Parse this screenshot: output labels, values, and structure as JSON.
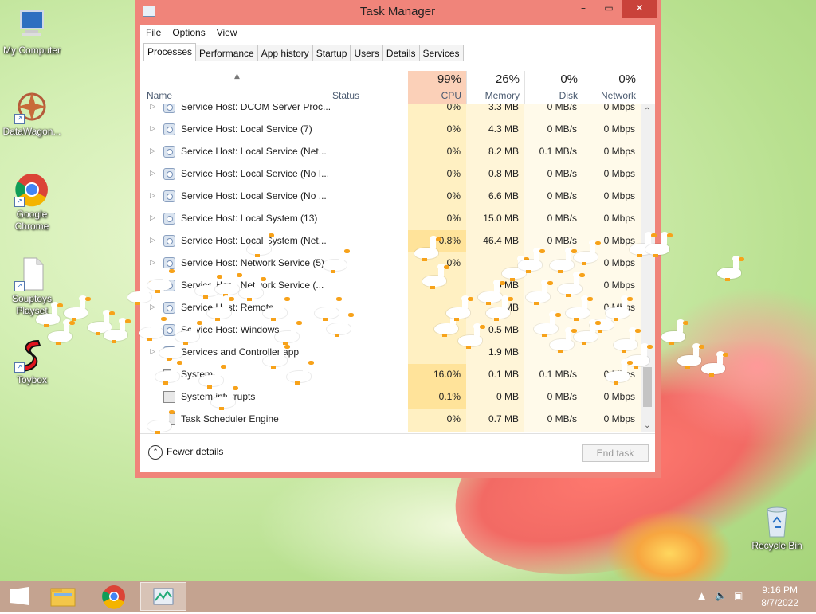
{
  "desktop": {
    "icons": [
      {
        "label": "My Computer"
      },
      {
        "label": "DataWagon..."
      },
      {
        "label": "Google Chrome"
      },
      {
        "label": "Souptoys Playset"
      },
      {
        "label": "Toybox"
      },
      {
        "label": "Recycle Bin"
      }
    ]
  },
  "window": {
    "title": "Task Manager",
    "menu": [
      "File",
      "Options",
      "View"
    ],
    "tabs": [
      "Processes",
      "Performance",
      "App history",
      "Startup",
      "Users",
      "Details",
      "Services"
    ],
    "active_tab": "Processes",
    "columns": {
      "name": "Name",
      "status": "Status",
      "cpu": {
        "pct": "99%",
        "label": "CPU"
      },
      "memory": {
        "pct": "26%",
        "label": "Memory"
      },
      "disk": {
        "pct": "0%",
        "label": "Disk"
      },
      "network": {
        "pct": "0%",
        "label": "Network"
      }
    },
    "rows": [
      {
        "name": "Service Host: DCOM Server Proc...",
        "cpu": "0%",
        "mem": "3.3 MB",
        "disk": "0 MB/s",
        "net": "0 Mbps",
        "icon": "gear"
      },
      {
        "name": "Service Host: Local Service (7)",
        "cpu": "0%",
        "mem": "4.3 MB",
        "disk": "0 MB/s",
        "net": "0 Mbps",
        "icon": "gear"
      },
      {
        "name": "Service Host: Local Service (Net...",
        "cpu": "0%",
        "mem": "8.2 MB",
        "disk": "0.1 MB/s",
        "net": "0 Mbps",
        "icon": "gear"
      },
      {
        "name": "Service Host: Local Service (No I...",
        "cpu": "0%",
        "mem": "0.8 MB",
        "disk": "0 MB/s",
        "net": "0 Mbps",
        "icon": "gear"
      },
      {
        "name": "Service Host: Local Service (No ...",
        "cpu": "0%",
        "mem": "6.6 MB",
        "disk": "0 MB/s",
        "net": "0 Mbps",
        "icon": "gear"
      },
      {
        "name": "Service Host: Local System (13)",
        "cpu": "0%",
        "mem": "15.0 MB",
        "disk": "0 MB/s",
        "net": "0 Mbps",
        "icon": "gear"
      },
      {
        "name": "Service Host: Local System (Net...",
        "cpu": "0.8%",
        "mem": "46.4 MB",
        "disk": "0 MB/s",
        "net": "0 Mbps",
        "icon": "gear"
      },
      {
        "name": "Service Host: Network Service (5)",
        "cpu": "0%",
        "mem": "",
        "disk": "",
        "net": "0 Mbps",
        "icon": "gear"
      },
      {
        "name": "Service Host: Network Service (...",
        "cpu": "",
        "mem": "6 MB",
        "disk": "",
        "net": "0 Mbps",
        "icon": "gear"
      },
      {
        "name": "Service Host: Remote ...",
        "cpu": "",
        "mem": "MB",
        "disk": "",
        "net": "0 Mbps",
        "icon": "gear"
      },
      {
        "name": "Service Host: Windows ...",
        "cpu": "",
        "mem": "0.5 MB",
        "disk": "",
        "net": "",
        "icon": "gear"
      },
      {
        "name": "Services and Controller app",
        "cpu": "",
        "mem": "1.9 MB",
        "disk": "",
        "net": "",
        "icon": "gear"
      },
      {
        "name": "System",
        "cpu": "16.0%",
        "mem": "0.1 MB",
        "disk": "0.1 MB/s",
        "net": "0 Mbps",
        "icon": "sys"
      },
      {
        "name": "System interrupts",
        "cpu": "0.1%",
        "mem": "0 MB",
        "disk": "0 MB/s",
        "net": "0 Mbps",
        "icon": "sys"
      },
      {
        "name": "Task Scheduler Engine",
        "cpu": "0%",
        "mem": "0.7 MB",
        "disk": "0 MB/s",
        "net": "0 Mbps",
        "icon": "sys"
      }
    ],
    "fewer_details": "Fewer details",
    "end_task": "End task"
  },
  "taskbar": {
    "time": "9:16 PM",
    "date": "8/7/2022"
  }
}
